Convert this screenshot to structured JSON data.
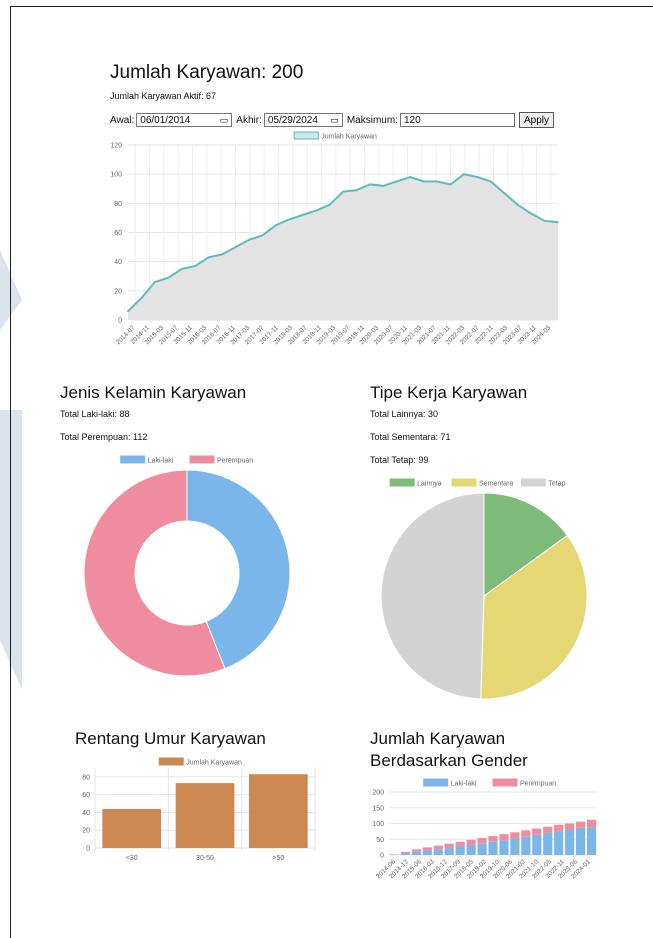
{
  "header": {
    "title": "Jumlah Karyawan: 200",
    "active": "Jumlah Karyawan Aktif: 67"
  },
  "filters": {
    "start_label": "Awal:",
    "start_value": "06/01/2014",
    "end_label": "Akhir:",
    "end_value": "05/29/2024",
    "max_label": "Maksimum:",
    "max_value": "120",
    "apply_label": "Apply"
  },
  "gender": {
    "title": "Jenis Kelamin Karyawan",
    "male_total": "Total Laki-laki: 88",
    "female_total": "Total Perempuan: 112"
  },
  "worktype": {
    "title": "Tipe Kerja Karyawan",
    "other_total": "Total Lainnya: 30",
    "temp_total": "Total Sementara: 71",
    "perm_total": "Total Tetap: 99"
  },
  "age": {
    "title": "Rentang Umur Karyawan"
  },
  "gender_over_time": {
    "title_line1": "Jumlah Karyawan",
    "title_line2": "Berdasarkan Gender"
  },
  "colors": {
    "line": "#5bbcbc",
    "area": "#e3e3e3",
    "male": "#7ab6ea",
    "female": "#f08ca0",
    "other": "#7dbb7b",
    "temp": "#e5d774",
    "perm": "#d3d3d3",
    "age_bar": "#cd8750",
    "deco": "#dde3eb"
  },
  "chart_data": [
    {
      "type": "area",
      "series": [
        {
          "name": "Jumlah Karyawan"
        }
      ],
      "x_ticks": [
        "2014-07",
        "2014-11",
        "2015-03",
        "2015-07",
        "2015-11",
        "2016-03",
        "2016-07",
        "2016-11",
        "2017-03",
        "2017-07",
        "2017-11",
        "2018-03",
        "2018-07",
        "2018-11",
        "2019-03",
        "2019-07",
        "2019-11",
        "2020-03",
        "2020-07",
        "2020-11",
        "2021-03",
        "2021-07",
        "2021-11",
        "2022-03",
        "2022-07",
        "2022-11",
        "2023-03",
        "2023-07",
        "2023-11",
        "2024-03"
      ],
      "x": [
        "2014-06",
        "2014-10",
        "2015-01",
        "2015-06",
        "2015-11",
        "2016-02",
        "2016-06",
        "2016-09",
        "2017-01",
        "2017-06",
        "2017-10",
        "2018-02",
        "2018-06",
        "2018-10",
        "2019-02",
        "2019-07",
        "2019-10",
        "2020-01",
        "2020-06",
        "2020-10",
        "2021-02",
        "2021-05",
        "2021-07",
        "2021-11",
        "2022-03",
        "2022-07",
        "2022-10",
        "2023-02",
        "2023-06",
        "2023-09",
        "2023-12",
        "2024-03",
        "2024-05"
      ],
      "values": [
        6,
        15,
        26,
        29,
        35,
        37,
        43,
        45,
        50,
        55,
        58,
        65,
        69,
        72,
        75,
        79,
        88,
        89,
        93,
        92,
        95,
        98,
        95,
        95,
        93,
        100,
        98,
        95,
        87,
        79,
        73,
        68,
        67
      ],
      "yticks": [
        0,
        20,
        40,
        60,
        80,
        100,
        120
      ],
      "ylim": [
        0,
        120
      ],
      "grid": true,
      "legend": "top"
    },
    {
      "type": "pie",
      "variant": "doughnut",
      "labels": [
        "Laki-laki",
        "Perempuan"
      ],
      "values": [
        88,
        112
      ],
      "legend": "top"
    },
    {
      "type": "pie",
      "labels": [
        "Lainnya",
        "Sementara",
        "Tetap"
      ],
      "values": [
        30,
        71,
        99
      ],
      "legend": "top"
    },
    {
      "type": "bar",
      "series": [
        {
          "name": "Jumlah Karyawan"
        }
      ],
      "categories": [
        "<30",
        "30-50",
        ">50"
      ],
      "values": [
        44,
        73,
        83
      ],
      "yticks": [
        0,
        20,
        40,
        60,
        80
      ],
      "ylim": [
        0,
        90
      ],
      "legend": "top"
    },
    {
      "type": "bar",
      "stacked": true,
      "x_ticks": [
        "2014-06",
        "2014-12",
        "2015-06",
        "2016-03",
        "2016-12",
        "2017-09",
        "2018-05",
        "2019-02",
        "2019-10",
        "2020-06",
        "2021-02",
        "2021-10",
        "2022-05",
        "2022-11",
        "2023-06",
        "2024-01"
      ],
      "series": [
        {
          "name": "Laki-laki",
          "values": [
            2,
            6,
            10,
            14,
            18,
            22,
            27,
            32,
            37,
            42,
            47,
            52,
            58,
            64,
            70,
            75,
            81,
            86,
            88
          ]
        },
        {
          "name": "Perempuan",
          "values": [
            2,
            10,
            18,
            24,
            30,
            36,
            42,
            48,
            54,
            60,
            66,
            72,
            78,
            84,
            90,
            96,
            100,
            106,
            112
          ]
        }
      ],
      "yticks": [
        0,
        50,
        100,
        150,
        200
      ],
      "ylim": [
        0,
        200
      ],
      "legend": "top"
    }
  ]
}
